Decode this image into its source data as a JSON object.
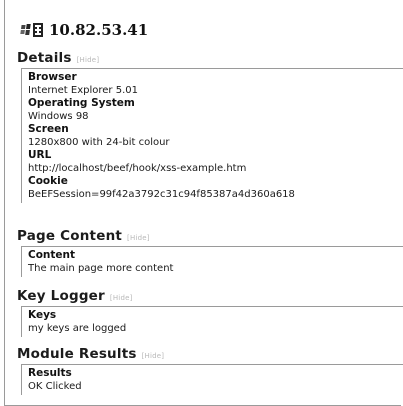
{
  "header": {
    "icons": [
      "windows-logo-icon",
      "ie-logo-icon"
    ],
    "host": "10.82.53.41"
  },
  "hide_label": "[Hide]",
  "details": {
    "title": "Details",
    "fields": [
      {
        "label": "Browser",
        "value": "Internet Explorer 5.01"
      },
      {
        "label": "Operating System",
        "value": "Windows 98"
      },
      {
        "label": "Screen",
        "value": "1280x800 with 24-bit colour"
      },
      {
        "label": "URL",
        "value": "http://localhost/beef/hook/xss-example.htm"
      },
      {
        "label": "Cookie",
        "value": "BeEFSession=99f42a3792c31c94f85387a4d360a618"
      }
    ]
  },
  "page_content": {
    "title": "Page Content",
    "label": "Content",
    "value": "The main page more content"
  },
  "key_logger": {
    "title": "Key Logger",
    "label": "Keys",
    "value": "my keys are logged"
  },
  "module_results": {
    "title": "Module Results",
    "label": "Results",
    "value": "OK Clicked"
  }
}
